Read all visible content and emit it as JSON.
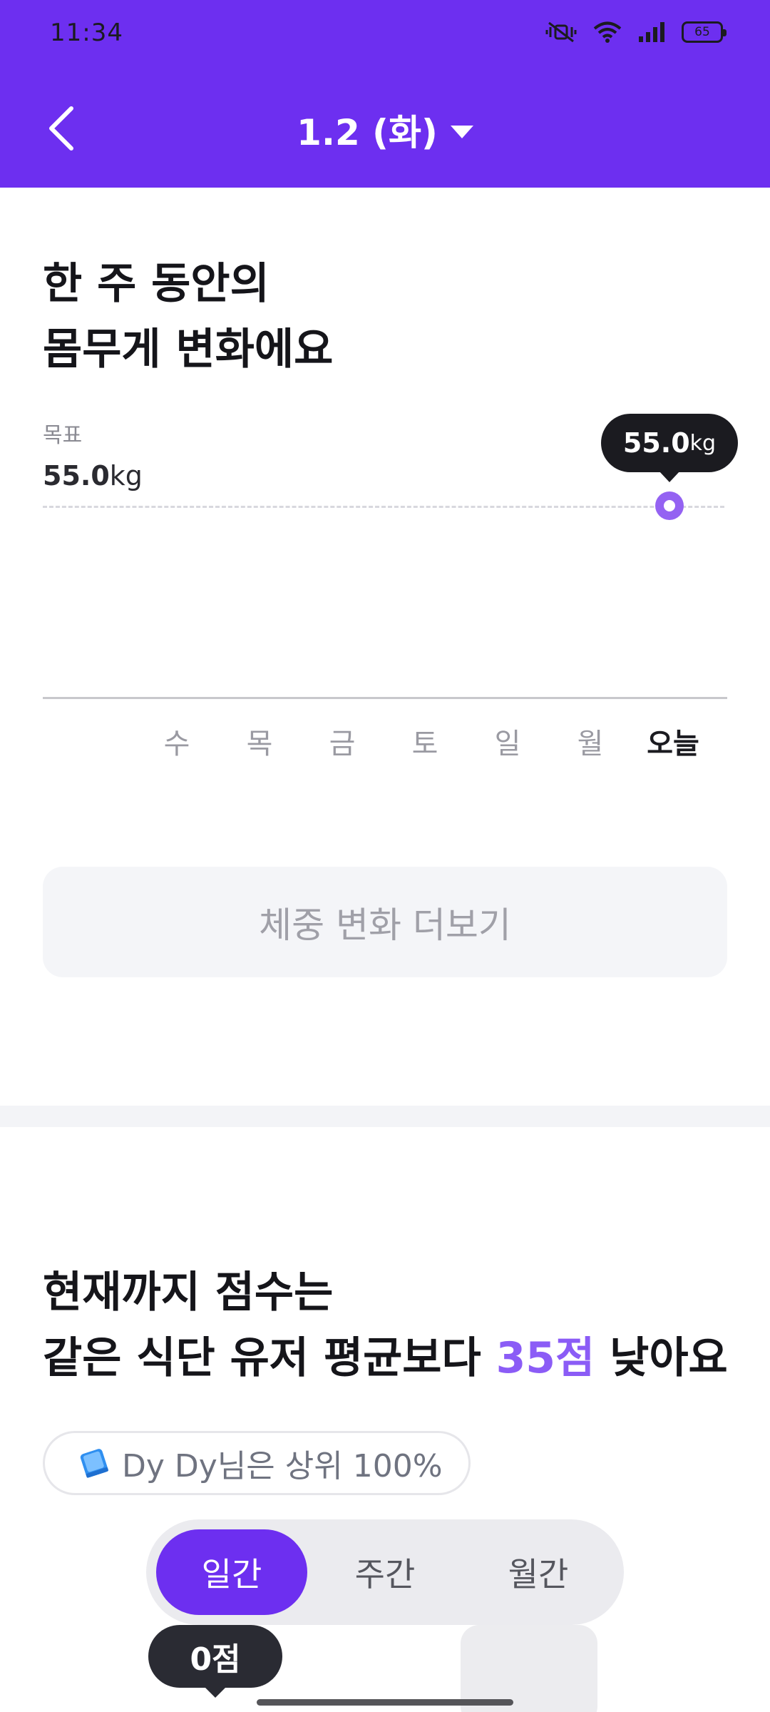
{
  "status_bar": {
    "time": "11:34",
    "battery": "65"
  },
  "header": {
    "date": "1.2 (화)"
  },
  "weight_section": {
    "title_line1": "한 주 동안의",
    "title_line2": "몸무게 변화에요",
    "goal_label": "목표",
    "goal_number": "55.0",
    "goal_unit": "kg",
    "tooltip_number": "55.0",
    "tooltip_unit": "kg",
    "days": [
      "수",
      "목",
      "금",
      "토",
      "일",
      "월",
      "오늘"
    ],
    "more_button": "체중 변화 더보기"
  },
  "chart_data": {
    "type": "line",
    "x": [
      "수",
      "목",
      "금",
      "토",
      "일",
      "월",
      "오늘"
    ],
    "series": [
      {
        "values": [
          null,
          null,
          null,
          null,
          null,
          null,
          55.0
        ]
      }
    ],
    "goal": 55.0
  },
  "score_section": {
    "title_line1": "현재까지 점수는",
    "title_line2_prefix": "같은 식단 유저 평균보다 ",
    "title_line2_accent": "35점",
    "title_line2_suffix": " 낮아요",
    "rank_text": "Dy Dy님은 상위 100%",
    "tabs": [
      "일간",
      "주간",
      "월간"
    ],
    "score_badge": "0점"
  },
  "colors": {
    "brand": "#6d2ff0",
    "accent": "#8b5cf6",
    "point": "#9462f2"
  }
}
